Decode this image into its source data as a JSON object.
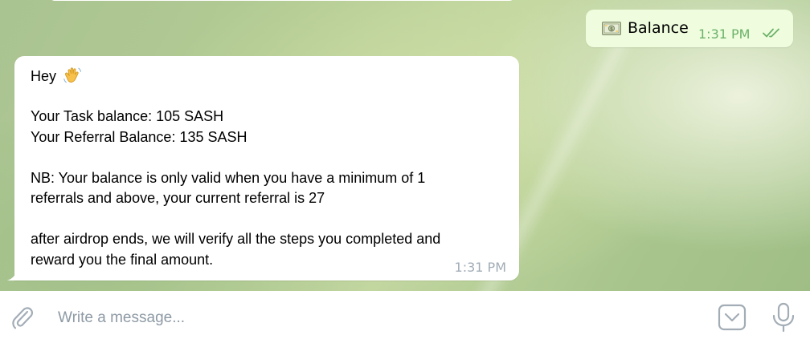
{
  "colors": {
    "accent": "#5fa8d3",
    "outgoing_bubble": "#effdde",
    "outgoing_time": "#6bb16a",
    "incoming_time": "#a0acb6",
    "placeholder": "#8e9aa5"
  },
  "outgoing_message": {
    "icon": "money-icon",
    "text": "Balance",
    "time": "1:31 PM",
    "status_icon": "double-check-icon"
  },
  "incoming_message": {
    "greeting": "Hey",
    "greeting_icon": "waving-hand-icon",
    "lines": [
      "Your Task balance: 105 SASH",
      "Your Referral Balance: 135 SASH",
      "NB: Your balance is only valid when you have a minimum of 1",
      "referrals and above, your current referral is 27",
      "after airdrop ends, we will verify all the steps you completed and",
      "reward you the final amount."
    ],
    "time": "1:31 PM"
  },
  "composer": {
    "placeholder": "Write a message...",
    "attach_icon": "paperclip-icon",
    "emoji_icon": "emoji-keyboard-icon",
    "mic_icon": "microphone-icon"
  }
}
